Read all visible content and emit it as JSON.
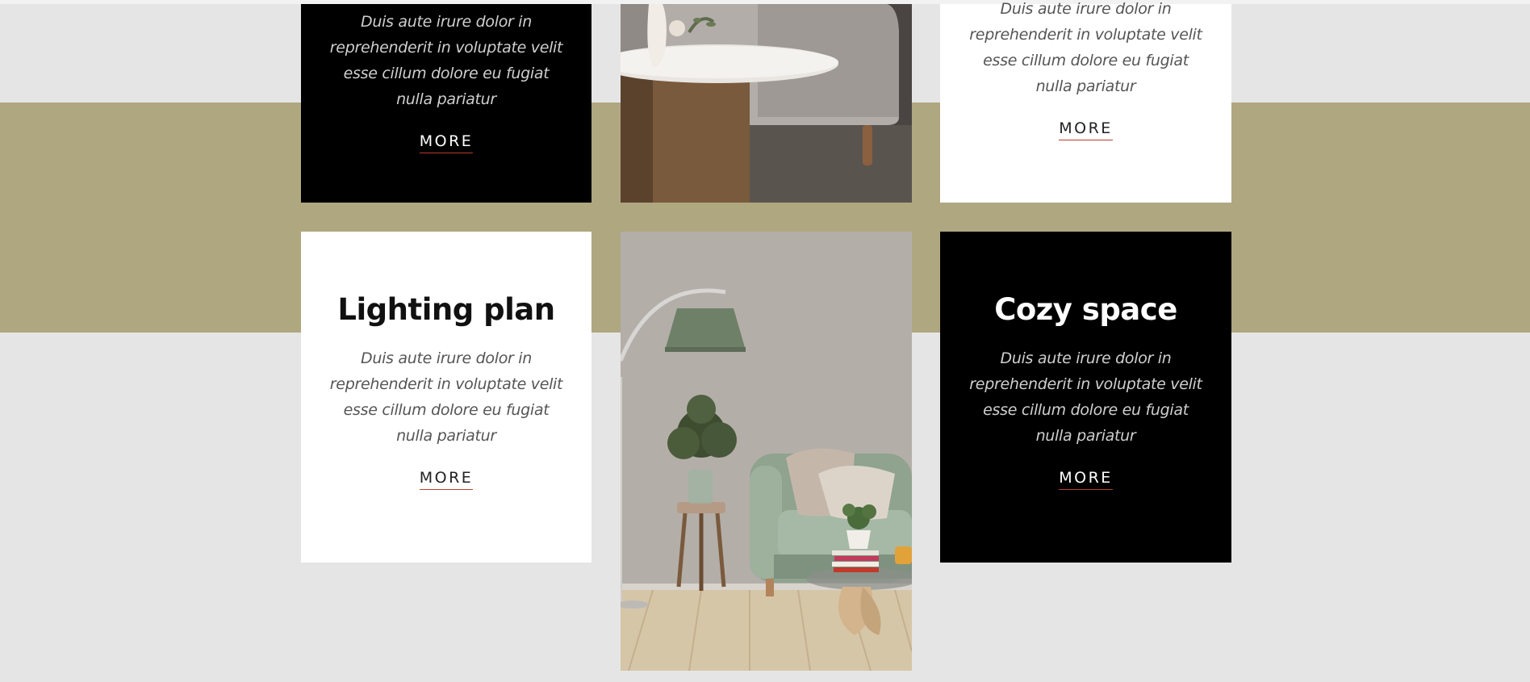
{
  "cards": {
    "top_left": {
      "body": "Duis aute irure dolor in reprehenderit in voluptate velit esse cillum dolore eu fugiat nulla pariatur",
      "more_label": "MORE"
    },
    "top_right": {
      "body": "Duis aute irure dolor in reprehenderit in voluptate velit esse cillum dolore eu fugiat nulla pariatur",
      "more_label": "MORE"
    },
    "lighting_plan": {
      "title": "Lighting plan",
      "body": "Duis aute irure dolor in reprehenderit in voluptate velit esse cillum dolore eu fugiat nulla pariatur",
      "more_label": "MORE"
    },
    "cozy_space": {
      "title": "Cozy space",
      "body": "Duis aute irure dolor in reprehenderit in voluptate velit esse cillum dolore eu fugiat nulla pariatur",
      "more_label": "MORE"
    }
  },
  "colors": {
    "page_background": "#e5e5e5",
    "band": "#afa780",
    "dark_card": "#000000",
    "light_card": "#ffffff",
    "link_underline": "#c0392b"
  }
}
